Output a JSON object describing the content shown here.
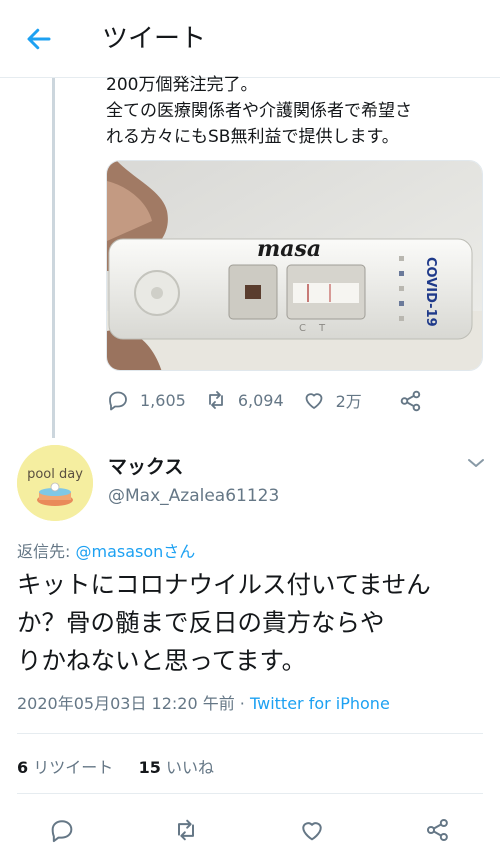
{
  "header": {
    "title": "ツイート"
  },
  "parent_tweet": {
    "text_lines": [
      "200万個発注完了。",
      "全ての医療関係者や介護関係者で希望さ",
      "れる方々にもSB無利益で提供します。"
    ],
    "media": {
      "handwriting": "masa",
      "cassette_label": "COVID-19",
      "window_labels": [
        "C",
        "T"
      ]
    },
    "stats": {
      "replies": "1,605",
      "retweets": "6,094",
      "likes": "2万"
    }
  },
  "reply_tweet": {
    "author": {
      "name": "マックス",
      "handle": "@Max_Azalea61123",
      "avatar_text": "pool day"
    },
    "reply_to": {
      "prefix": "返信先: ",
      "mention": "@masasonさん"
    },
    "text_lines": [
      "キットにコロナウイルス付いてません",
      "か？骨の髄まで反日の貴方ならや",
      "りかねないと思ってます。"
    ],
    "timestamp": "2020年05月03日 12:20 午前 · ",
    "source": "Twitter for iPhone",
    "retweet_count": "6",
    "retweet_label": " リツイート",
    "like_count": "15",
    "like_label": " いいね"
  },
  "colors": {
    "accent": "#1da1f2",
    "secondary_text": "#657786",
    "divider": "#e6ecf0"
  },
  "icons": [
    "back-arrow-icon",
    "reply-icon",
    "retweet-icon",
    "like-icon",
    "share-icon",
    "caret-down-icon"
  ]
}
